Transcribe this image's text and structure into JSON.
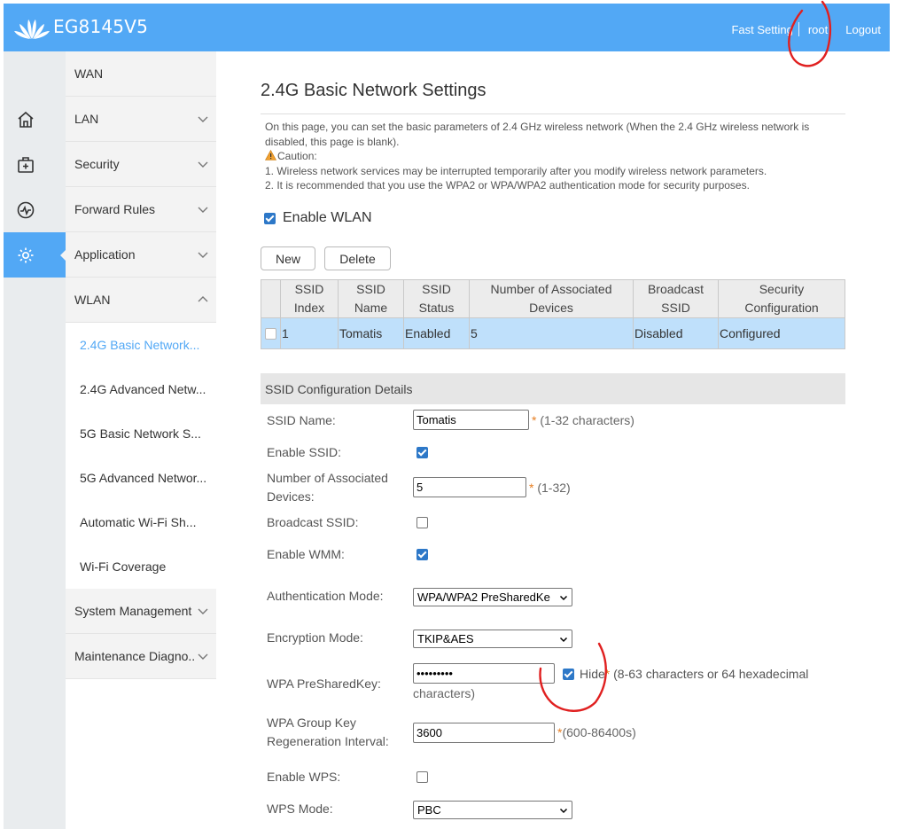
{
  "header": {
    "brand": "EG8145V5",
    "fast_setting": "Fast Setting",
    "user": "root",
    "logout": "Logout",
    "bg_color": "#52a8f5"
  },
  "iconbar": [
    {
      "icon": "home-icon"
    },
    {
      "icon": "toolbox-icon"
    },
    {
      "icon": "activity-icon"
    },
    {
      "icon": "gear-icon",
      "active": true
    }
  ],
  "sidebar": {
    "items": [
      {
        "label": "WAN"
      },
      {
        "label": "LAN"
      },
      {
        "label": "Security"
      },
      {
        "label": "Forward Rules"
      },
      {
        "label": "Application"
      },
      {
        "label": "WLAN"
      }
    ],
    "wlan_sub": [
      {
        "label": "2.4G Basic Network..."
      },
      {
        "label": "2.4G Advanced Netw..."
      },
      {
        "label": "5G Basic Network S..."
      },
      {
        "label": "5G Advanced Networ..."
      },
      {
        "label": "Automatic Wi-Fi Sh..."
      },
      {
        "label": "Wi-Fi Coverage"
      }
    ],
    "bottom_items": [
      {
        "label": "System Management"
      },
      {
        "label": "Maintenance Diagno.."
      }
    ]
  },
  "main": {
    "title": "2.4G Basic Network Settings",
    "desc_line1": "On this page, you can set the basic parameters of 2.4 GHz wireless network (When the 2.4 GHz wireless network is disabled, this page is blank).",
    "caution": "Caution:",
    "note1": "1. Wireless network services may be interrupted temporarily after you modify wireless network parameters.",
    "note2": "2. It is recommended that you use the WPA2 or WPA/WPA2 authentication mode for security purposes.",
    "enable_wlan": "Enable WLAN",
    "new_button": "New",
    "delete_button": "Delete"
  },
  "table": {
    "headers": [
      "SSID Index",
      "SSID Name",
      "SSID Status",
      "Number of Associated Devices",
      "Broadcast SSID",
      "Security Configuration"
    ],
    "rows": [
      {
        "index": "1",
        "name": "Tomatis",
        "status": "Enabled",
        "devices": "5",
        "broadcast": "Disabled",
        "security": "Configured"
      }
    ]
  },
  "config": {
    "section_title": "SSID Configuration Details",
    "ssid_name_label": "SSID Name:",
    "ssid_name_value": "Tomatis",
    "ssid_name_hint": "(1-32 characters)",
    "enable_ssid_label": "Enable SSID:",
    "assoc_label_1": "Number of Associated",
    "assoc_label_2": "Devices:",
    "assoc_value": "5",
    "assoc_hint": "(1-32)",
    "broadcast_label": "Broadcast SSID:",
    "wmm_label": "Enable WMM:",
    "auth_label": "Authentication Mode:",
    "auth_value": "WPA/WPA2 PreSharedKe",
    "enc_label": "Encryption Mode:",
    "enc_value": "TKIP&AES",
    "psk_label": "WPA PreSharedKey:",
    "psk_value": "•••••••••",
    "hide_label": "Hide",
    "psk_hint_1": "(8-63 characters or 64 hexadecimal",
    "psk_hint_2": "characters)",
    "rekey_label_1": "WPA Group Key",
    "rekey_label_2": "Regeneration Interval:",
    "rekey_value": "3600",
    "rekey_hint": "(600-86400s)",
    "wps_label": "Enable WPS:",
    "wps_mode_label": "WPS Mode:",
    "wps_mode_value": "PBC",
    "required_mark": "*"
  },
  "annotation_color": "#e02020"
}
